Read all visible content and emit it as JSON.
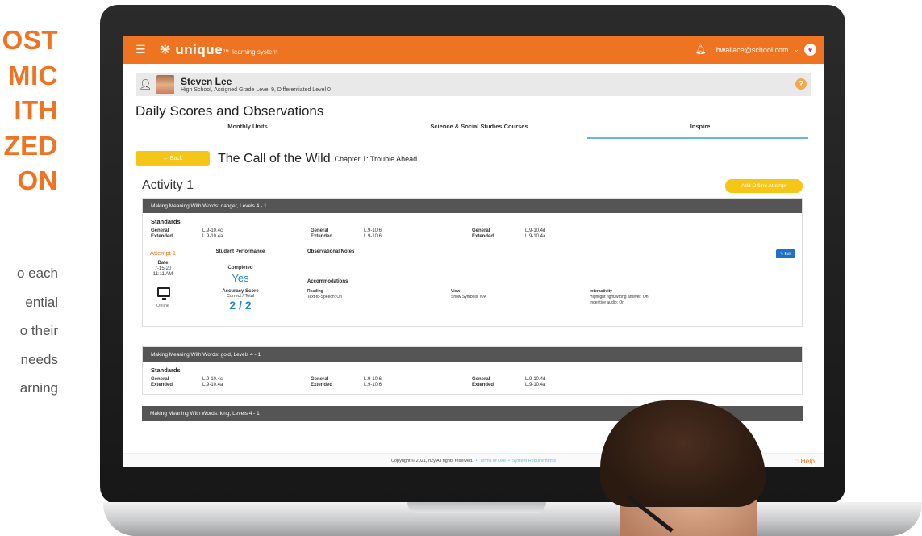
{
  "promo": {
    "heading_lines": [
      "OST",
      "MIC",
      "ITH",
      "ZED",
      "ON"
    ],
    "body_lines": [
      "o each",
      "ential",
      "o their",
      "needs",
      "arning"
    ]
  },
  "topbar": {
    "hamburger_icon": "hamburger-menu-icon",
    "logo_mark": "❋",
    "logo_text": "unique",
    "logo_tm": "™",
    "logo_sub": "learning system",
    "bell_icon": "bell-icon",
    "user_email": "bwallace@school.com",
    "chevron": "⌄",
    "user_icon": "heart-icon"
  },
  "student": {
    "name": "Steven Lee",
    "info": "High School, Assigned Grade Level 9, Differentiated Level 0"
  },
  "page_title": "Daily Scores and Observations",
  "tabs": [
    {
      "label": "Monthly Units"
    },
    {
      "label": "Science & Social Studies Courses"
    },
    {
      "label": "Inspire"
    }
  ],
  "book": {
    "back_label": "← Back",
    "title": "The Call of the Wild",
    "chapter": "Chapter 1: Trouble Ahead"
  },
  "activity": {
    "title": "Activity 1",
    "offline_label": "Add Offline Attempt"
  },
  "cards": [
    {
      "header": "Making Meaning With Words: danger, Levels 4 - 1",
      "standards_title": "Standards",
      "standards": [
        {
          "label_general": "General",
          "label_extended": "Extended",
          "general": "L.9-10.4c",
          "extended": "L.9-10.4a"
        },
        {
          "label_general": "General",
          "label_extended": "Extended",
          "general": "L.9-10.6",
          "extended": "L.9-10.6"
        },
        {
          "label_general": "General",
          "label_extended": "Extended",
          "general": "L.9-10.4d",
          "extended": "L.9-10.4a"
        }
      ],
      "attempt": {
        "title": "Attempt 1",
        "date_label": "Date",
        "date": "7-15-20",
        "time": "11:11 AM",
        "mode": "Online",
        "performance_header": "Student Performance",
        "completed_label": "Completed",
        "completed_value": "Yes",
        "accuracy_label": "Accuracy Score",
        "accuracy_sub": "Correct / Total",
        "accuracy_value": "2 / 2",
        "notes_header": "Observational Notes",
        "edit_label": "✎ Edit",
        "accommodations_header": "Accommodations",
        "accommodations": [
          {
            "label": "Reading",
            "line1": "Text-to-Speech: On",
            "line2": ""
          },
          {
            "label": "View",
            "line1": "Show Symbols: N/A",
            "line2": ""
          },
          {
            "label": "Interactivity",
            "line1": "Highlight right/wrong answer: On",
            "line2": "Incentive audio: On"
          }
        ]
      }
    },
    {
      "header": "Making Meaning With Words: gold, Levels 4 - 1",
      "standards_title": "Standards",
      "standards": [
        {
          "label_general": "General",
          "label_extended": "Extended",
          "general": "L.9-10.4c",
          "extended": "L.9-10.4a"
        },
        {
          "label_general": "General",
          "label_extended": "Extended",
          "general": "L.9-10.6",
          "extended": "L.9-10.6"
        },
        {
          "label_general": "General",
          "label_extended": "Extended",
          "general": "L.9-10.4d",
          "extended": "L.9-10.4a"
        }
      ]
    },
    {
      "header": "Making Meaning With Words: king, Levels 4 - 1"
    }
  ],
  "footer": {
    "copyright": "Copyright © 2021, n2y All rights reserved.",
    "sep1": "•",
    "terms": "Terms of Use",
    "sep2": "•",
    "requirements": "System Requirements",
    "help": "◌ Help"
  }
}
